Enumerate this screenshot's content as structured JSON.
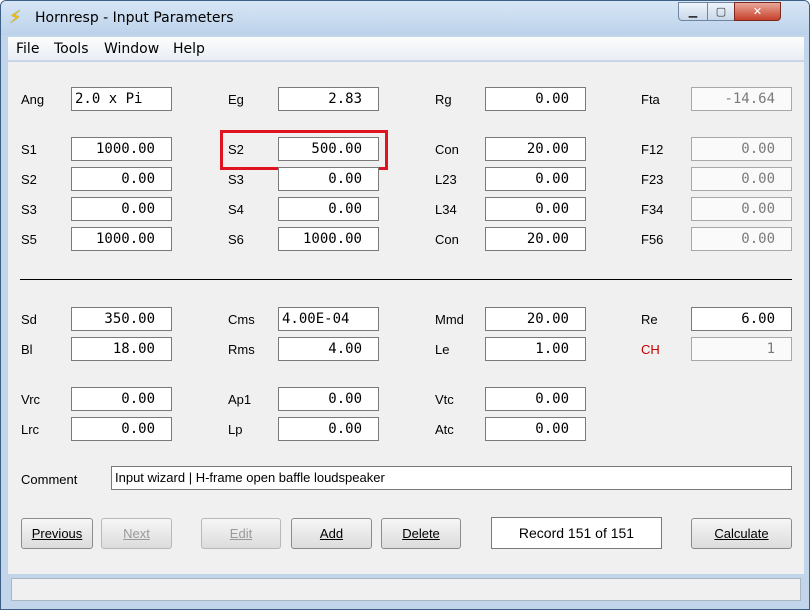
{
  "window": {
    "title": "Hornresp - Input Parameters",
    "app_icon": "lightning-bolt-icon"
  },
  "menu": {
    "file": "File",
    "tools": "Tools",
    "window": "Window",
    "help": "Help"
  },
  "rows": {
    "r1": [
      {
        "label": "Ang",
        "value": "2.0 x Pi"
      },
      {
        "label": "Eg",
        "value": "2.83"
      },
      {
        "label": "Rg",
        "value": "0.00"
      },
      {
        "label": "Fta",
        "value": "-14.64"
      }
    ],
    "r2": [
      {
        "label": "S1",
        "value": "1000.00"
      },
      {
        "label": "S2",
        "value": "500.00"
      },
      {
        "label": "Con",
        "value": "20.00"
      },
      {
        "label": "F12",
        "value": "0.00"
      }
    ],
    "r3": [
      {
        "label": "S2",
        "value": "0.00"
      },
      {
        "label": "S3",
        "value": "0.00"
      },
      {
        "label": "L23",
        "value": "0.00"
      },
      {
        "label": "F23",
        "value": "0.00"
      }
    ],
    "r4": [
      {
        "label": "S3",
        "value": "0.00"
      },
      {
        "label": "S4",
        "value": "0.00"
      },
      {
        "label": "L34",
        "value": "0.00"
      },
      {
        "label": "F34",
        "value": "0.00"
      }
    ],
    "r5": [
      {
        "label": "S5",
        "value": "1000.00"
      },
      {
        "label": "S6",
        "value": "1000.00"
      },
      {
        "label": "Con",
        "value": "20.00"
      },
      {
        "label": "F56",
        "value": "0.00"
      }
    ],
    "r6": [
      {
        "label": "Sd",
        "value": "350.00"
      },
      {
        "label": "Cms",
        "value": "4.00E-04"
      },
      {
        "label": "Mmd",
        "value": "20.00"
      },
      {
        "label": "Re",
        "value": "6.00"
      }
    ],
    "r7": [
      {
        "label": "Bl",
        "value": "18.00"
      },
      {
        "label": "Rms",
        "value": "4.00"
      },
      {
        "label": "Le",
        "value": "1.00"
      },
      {
        "label": "CH",
        "value": "1"
      }
    ],
    "r8": [
      {
        "label": "Vrc",
        "value": "0.00"
      },
      {
        "label": "Ap1",
        "value": "0.00"
      },
      {
        "label": "Vtc",
        "value": "0.00"
      }
    ],
    "r9": [
      {
        "label": "Lrc",
        "value": "0.00"
      },
      {
        "label": "Lp",
        "value": "0.00"
      },
      {
        "label": "Atc",
        "value": "0.00"
      }
    ]
  },
  "comment": {
    "label": "Comment",
    "value": "Input wizard | H-frame open baffle loudspeaker"
  },
  "buttons": {
    "previous": "Previous",
    "next": "Next",
    "edit": "Edit",
    "add": "Add",
    "delete": "Delete",
    "calculate": "Calculate"
  },
  "record": "Record 151 of 151",
  "colors": {
    "highlight": "#e0141e",
    "ch_label": "#c00000"
  }
}
